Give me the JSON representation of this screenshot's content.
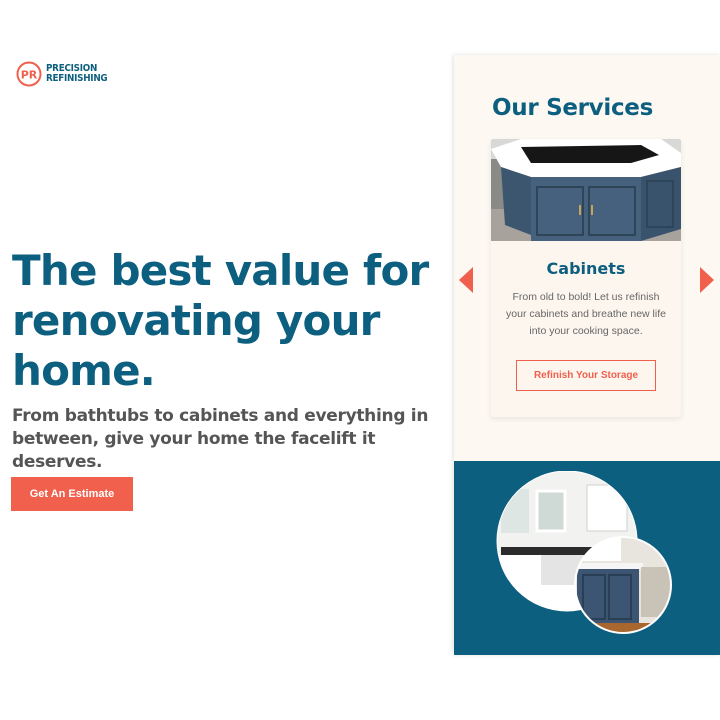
{
  "brand": {
    "logo_line1": "PRECISION",
    "logo_line2": "REFINISHING",
    "logo_mark": "PR-monogram-icon",
    "primary_color": "#0d5f80",
    "accent_color": "#f15f4d"
  },
  "hero": {
    "title": "The best value for renovating your home.",
    "subtitle": "From bathtubs to cabinets and everything in between, give your home the facelift it deserves.",
    "cta_label": "Get An Estimate"
  },
  "services": {
    "title": "Our Services",
    "card": {
      "image": "cabinet-island-photo",
      "title": "Cabinets",
      "text": "From old to bold! Let us refinish your cabinets and breathe new life into your cooking space.",
      "button_label": "Refinish Your Storage"
    },
    "prev_icon": "chevron-left-icon",
    "next_icon": "chevron-right-icon"
  },
  "gallery": {
    "image": "kitchen-before-after-circles"
  }
}
